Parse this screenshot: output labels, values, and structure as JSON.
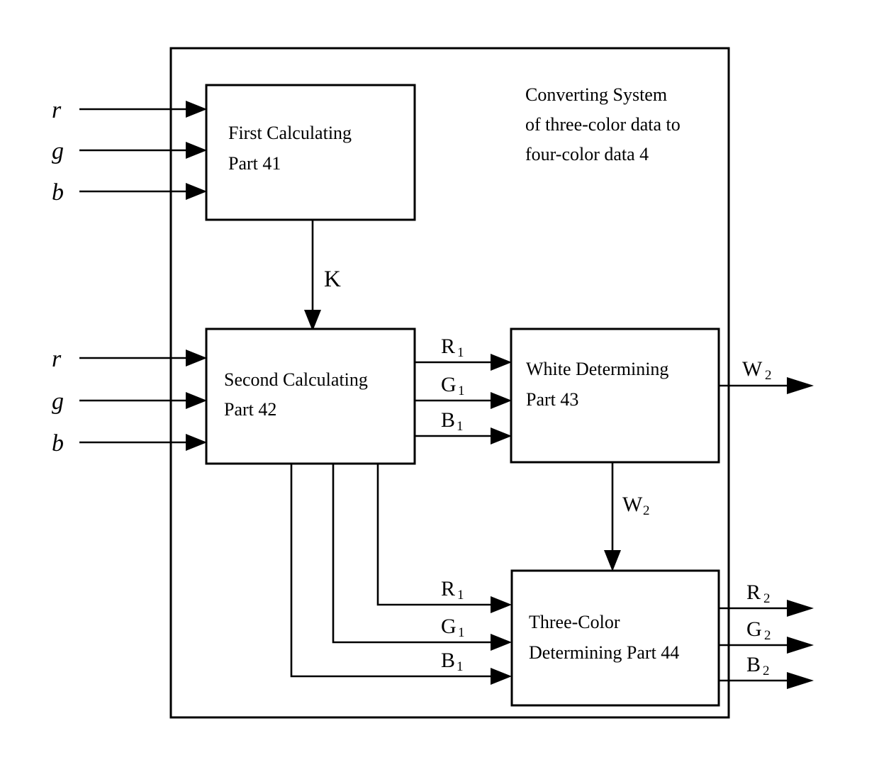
{
  "diagram": {
    "system_label": {
      "line1": "Converting    System",
      "line2": "of three-color data to",
      "line3": "four-color data    4"
    },
    "blocks": [
      {
        "id": "first-calculating-part",
        "line1": "First    Calculating",
        "line2": "Part 41"
      },
      {
        "id": "second-calculating-part",
        "line1": "Second   Calculating",
        "line2": "Part 42"
      },
      {
        "id": "white-determining-part",
        "line1": "White   Determining",
        "line2": "Part 43"
      },
      {
        "id": "three-color-determining-part",
        "line1": "Three-Color",
        "line2": "Determining Part 44"
      }
    ],
    "inputs_top": [
      {
        "label": "r"
      },
      {
        "label": "g"
      },
      {
        "label": "b"
      }
    ],
    "inputs_mid": [
      {
        "label": "r"
      },
      {
        "label": "g"
      },
      {
        "label": "b"
      }
    ],
    "signals": {
      "k": "K",
      "w2_internal": {
        "base": "W",
        "sub": "2"
      },
      "w2_output": {
        "base": "W",
        "sub": "2"
      },
      "r1_upper": {
        "base": "R",
        "sub": "1"
      },
      "g1_upper": {
        "base": "G",
        "sub": "1"
      },
      "b1_upper": {
        "base": "B",
        "sub": "1"
      },
      "r1_lower": {
        "base": "R",
        "sub": "1"
      },
      "g1_lower": {
        "base": "G",
        "sub": "1"
      },
      "b1_lower": {
        "base": "B",
        "sub": "1"
      },
      "r2_output": {
        "base": "R",
        "sub": "2"
      },
      "g2_output": {
        "base": "G",
        "sub": "2"
      },
      "b2_output": {
        "base": "B",
        "sub": "2"
      }
    },
    "colors": {
      "stroke": "#000000",
      "background": "#ffffff"
    }
  }
}
